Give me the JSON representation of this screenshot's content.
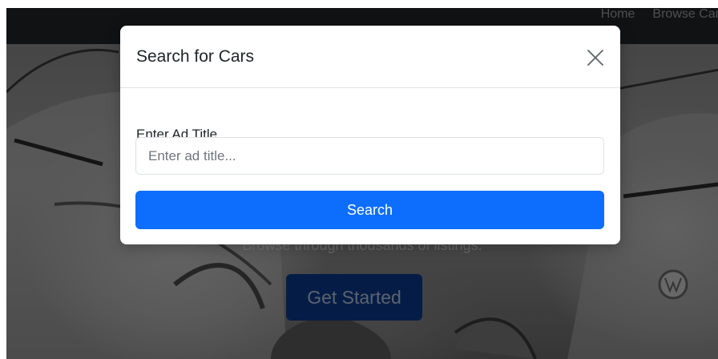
{
  "navbar": {
    "links": [
      {
        "label": "Home"
      },
      {
        "label": "Browse Cars"
      }
    ]
  },
  "hero": {
    "subtitle": "Browse through thousands of listings.",
    "cta_label": "Get Started"
  },
  "search_modal": {
    "title": "Search for Cars",
    "close_icon": "close-icon",
    "field_label": "Enter Ad Title",
    "input": {
      "value": "",
      "placeholder": "Enter ad title..."
    },
    "submit_label": "Search"
  },
  "colors": {
    "navbar_bg": "#212529",
    "primary": "#0d6efd",
    "backdrop": "rgba(0,0,0,0.5)"
  }
}
